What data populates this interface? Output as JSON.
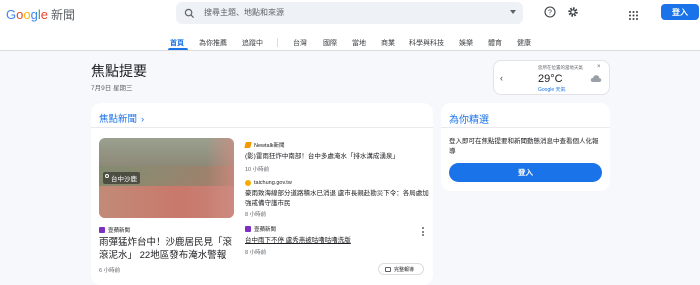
{
  "app": {
    "logo_letters": [
      "G",
      "o",
      "o",
      "g",
      "l",
      "e"
    ],
    "logo_suffix": "新聞"
  },
  "search": {
    "placeholder": "搜尋主題、地點和來源"
  },
  "header": {
    "signin_label": "登入"
  },
  "icons": {
    "search": "search-icon",
    "dropdown": "chevron-down-icon",
    "help": "help-icon",
    "settings": "gear-icon",
    "apps": "apps-grid-icon",
    "weather": "cloud-icon",
    "close": "close-icon",
    "prev": "chevron-left-icon",
    "next": "chevron-right-icon"
  },
  "nav": {
    "tabs": [
      "首頁",
      "為你推薦",
      "追蹤中",
      "台灣",
      "國際",
      "當地",
      "商業",
      "科學與科技",
      "娛樂",
      "體育",
      "健康"
    ],
    "active": "首頁"
  },
  "page": {
    "title": "焦點提要",
    "date": "7月9日 星期三"
  },
  "weather": {
    "caption": "您所在位置的當地天氣",
    "temp": "29°C",
    "source": "Google 天氣",
    "close": "×"
  },
  "main": {
    "section_title": "焦點新聞",
    "hero": {
      "image_tag": "台中沙鹿",
      "source": "壹蘋新聞",
      "headline": "雨彈猛炸台中！沙鹿居民見「滾滾泥水」 22地區發布淹水警報",
      "time": "6 小時前"
    },
    "articles": [
      {
        "source": "Newtalk新聞",
        "title": "(影)雷雨狂炸中南部！台中多處淹水「排水溝成湧泉」",
        "time": "10 小時前"
      },
      {
        "source": "taichung.gov.tw",
        "title": "豪雨致海線部分道路積水已消退 盧市長親赴勘災下令：各局處加強戒備守護市民",
        "time": "8 小時前"
      },
      {
        "source": "壹蘋新聞",
        "title": "台中雨下不停 盧秀燕被咕嚕咕嚕洗版",
        "time": "8 小時前"
      }
    ],
    "full_coverage_label": "完整報導"
  },
  "side": {
    "title": "為你精選",
    "text": "登入即可在焦點提要和新聞動態消息中查看個人化報導",
    "signin_label": "登入"
  },
  "colors": {
    "accent": "#1a73e8",
    "background": "#f6f8fc",
    "card": "#ffffff",
    "newtalk": "#f29900",
    "taichung": "#f9ab00",
    "nextapple": "#7b2fc4"
  }
}
